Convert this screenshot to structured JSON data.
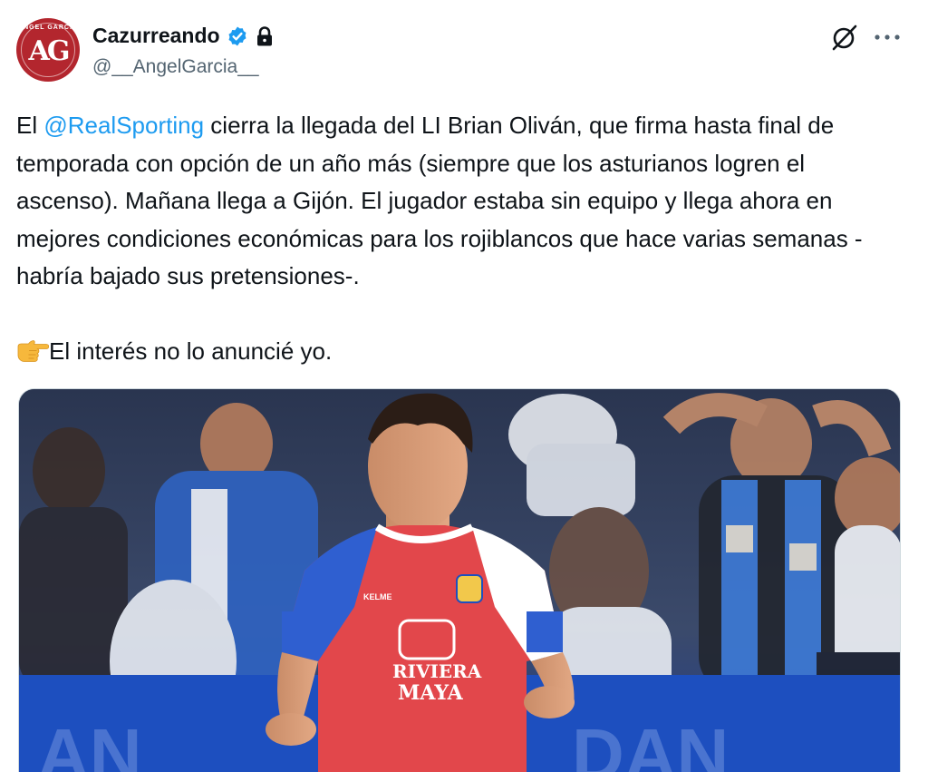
{
  "author": {
    "display_name": "Cazurreando",
    "handle": "@__AngelGarcia__",
    "avatar_monogram": "AG",
    "avatar_arc_text": "ANGEL GARCIA",
    "verified": true,
    "protected": true
  },
  "tweet": {
    "text_before_mention": "El ",
    "mention": "@RealSporting",
    "text_after_mention": " cierra la llegada del LI Brian Oliván, que firma hasta final de temporada con opción de un año más (siempre que los asturianos logren el ascenso). Mañana llega a Gijón. El jugador estaba sin equipo y llega ahora en mejores condiciones económicas para los rojiblancos que hace varias semanas -habría bajado sus pretensiones-.",
    "second_paragraph": "El interés no lo anuncié yo.",
    "second_paragraph_emoji": "pointing-hand-emoji"
  },
  "media": {
    "jersey_sponsor_line1": "RIVIERA",
    "jersey_sponsor_line2": "MAYA",
    "jersey_brand": "KELME"
  },
  "icons": {
    "grok": "grok-icon",
    "more": "more-icon",
    "verified": "verified-badge-icon",
    "lock": "lock-icon"
  },
  "colors": {
    "link": "#1d9bf0",
    "text": "#0f1419",
    "secondary_text": "#536471",
    "verified": "#1d9bf0",
    "avatar_bg": "#b3262e"
  }
}
